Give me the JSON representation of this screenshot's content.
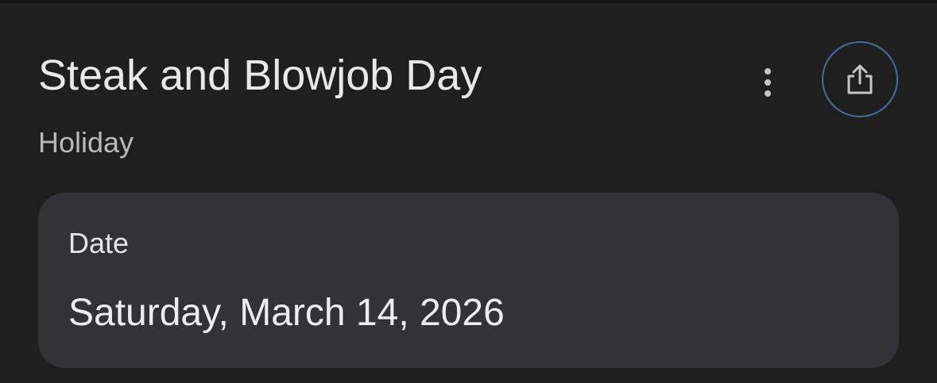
{
  "event": {
    "title": "Steak and Blowjob Day",
    "category": "Holiday"
  },
  "actions": {
    "more_icon": "more-vertical-icon",
    "share_icon": "share-icon"
  },
  "date_card": {
    "label": "Date",
    "value": "Saturday, March 14, 2026"
  },
  "colors": {
    "background": "#1f1f1f",
    "card": "#333337",
    "share_ring": "#4a6b9b"
  }
}
